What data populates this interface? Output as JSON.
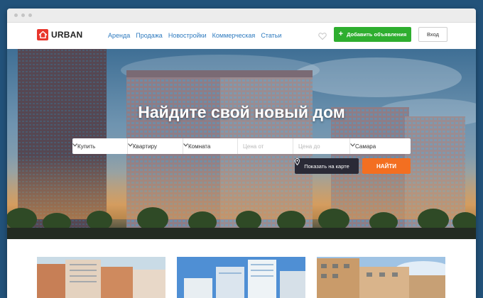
{
  "brand": {
    "name": "URBAN",
    "accent": "#e8362d"
  },
  "nav": {
    "items": [
      "Аренда",
      "Продажа",
      "Новостройки",
      "Коммерческая",
      "Статьи"
    ]
  },
  "header": {
    "favorite_icon": "heart-icon",
    "add_button": "Добавить объявления",
    "login_button": "Вход"
  },
  "hero": {
    "title": "Найдите свой новый дом",
    "search": {
      "deal": "Купить",
      "type": "Квартиру",
      "rooms": "Комната",
      "price_from_placeholder": "Цена от",
      "price_to_placeholder": "Цена до",
      "city": "Самара"
    },
    "map_button": "Показать на карте",
    "find_button": "НАЙТИ"
  },
  "colors": {
    "green": "#2eae2f",
    "orange": "#f36f21",
    "link": "#2f7bbf",
    "dark": "#2a2a36"
  }
}
